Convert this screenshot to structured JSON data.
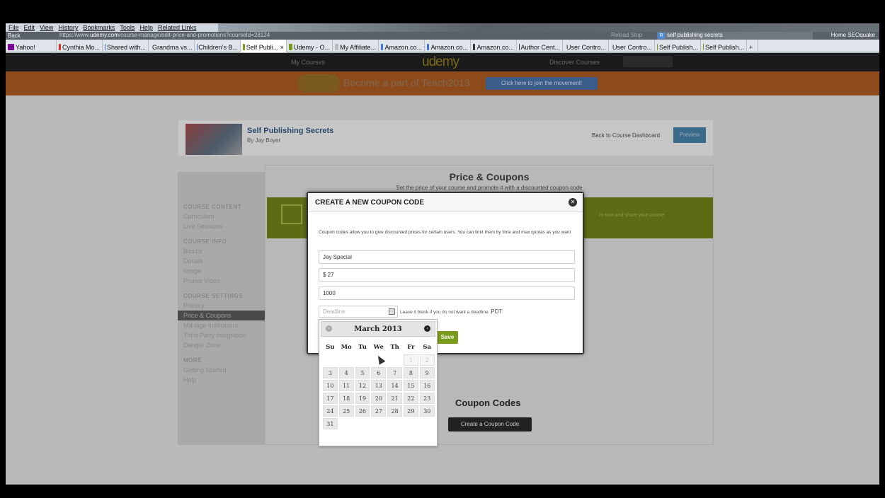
{
  "menubar": [
    "File",
    "Edit",
    "View",
    "History",
    "Bookmarks",
    "Tools",
    "Help",
    "Related Links"
  ],
  "nav": {
    "back": "Back",
    "url_prefix": "https://www.",
    "url_host": "udemy.com",
    "url_path": "/course-manage/edit-price-and-promotions?courseId=28124",
    "reload": "Reload",
    "stop": "Stop",
    "search_value": "self publishing secrets",
    "home": "Home",
    "seoquake": "SEOquake"
  },
  "tabs": [
    {
      "label": "Yahoo!",
      "color": "#7b0099"
    },
    {
      "label": "Cynthia Mo...",
      "color": "#d93025"
    },
    {
      "label": "Shared with...",
      "color": "#3a77d8"
    },
    {
      "label": "Grandma vs...",
      "color": "#3a77d8"
    },
    {
      "label": "Children's B...",
      "color": "#3a77d8"
    },
    {
      "label": "Self Publi... ×",
      "color": "#7a9a1a"
    },
    {
      "label": "Udemy - O...",
      "color": "#7a9a1a"
    },
    {
      "label": "My Affiliate...",
      "color": "#bbbbbb"
    },
    {
      "label": "Amazon.co...",
      "color": "#3a77d8"
    },
    {
      "label": "Amazon.co...",
      "color": "#3a77d8"
    },
    {
      "label": "Amazon.co...",
      "color": "#333333"
    },
    {
      "label": "Author Cent...",
      "color": "#333333"
    },
    {
      "label": "User Contro...",
      "color": "#3a77d8"
    },
    {
      "label": "User Contro...",
      "color": "#3a77d8"
    },
    {
      "label": "Self Publish...",
      "color": "#7a9a1a"
    },
    {
      "label": "Self Publish...",
      "color": "#7a9a1a"
    },
    {
      "label": "+",
      "color": ""
    }
  ],
  "site": {
    "my_courses": "My Courses",
    "logo": "udemy",
    "discover": "Discover Courses",
    "banner_text": "Become a part of Teach2013",
    "banner_button": "Click here to join the movement!"
  },
  "course": {
    "title": "Self Publishing Secrets",
    "by": "By Jay Boyer",
    "back_dashboard": "Back to Course Dashboard",
    "preview": "Preview"
  },
  "sidebar": {
    "sections": [
      {
        "heading": "COURSE CONTENT",
        "items": [
          "Curriculum",
          "Live Sessions"
        ]
      },
      {
        "heading": "COURSE INFO",
        "items": [
          "Basics",
          "Details",
          "Image",
          "Promo Video"
        ]
      },
      {
        "heading": "COURSE SETTINGS",
        "items": [
          "Privacy",
          "Price & Coupons",
          "Manage Instructors",
          "Third Party Integration",
          "Danger Zone"
        ]
      },
      {
        "heading": "MORE",
        "items": [
          "Getting Started",
          "Help"
        ]
      }
    ],
    "selected": "Price & Coupons"
  },
  "main": {
    "heading": "Price & Coupons",
    "subheading": "Set the price of your course and promote it with a discounted coupon code",
    "green_text": "is now and share your course",
    "coupons_heading": "Coupon Codes",
    "create_button": "Create a Coupon Code"
  },
  "modal": {
    "title": "CREATE A NEW COUPON CODE",
    "description": "Coupon codes allow you to give discounted prices for certain users. You can limit them by time and max quotas as you want",
    "code_value": "Jay Special",
    "price_value": "$ 27",
    "quota_value": "1000",
    "deadline_placeholder": "Deadline",
    "deadline_note": "Leave it blank if you do not want a deadline.",
    "timezone": "PDT",
    "save": "Save"
  },
  "datepicker": {
    "month_title": "March 2013",
    "weekdays": [
      "Su",
      "Mo",
      "Tu",
      "We",
      "Th",
      "Fr",
      "Sa"
    ],
    "weeks": [
      [
        null,
        null,
        null,
        null,
        null,
        {
          "d": "1",
          "muted": true
        },
        {
          "d": "2",
          "muted": true
        }
      ],
      [
        "3",
        "4",
        "5",
        "6",
        "7",
        "8",
        "9"
      ],
      [
        "10",
        "11",
        "12",
        "13",
        "14",
        "15",
        "16"
      ],
      [
        "17",
        "18",
        "19",
        "20",
        "21",
        "22",
        "23"
      ],
      [
        "24",
        "25",
        "26",
        "27",
        "28",
        "29",
        "30"
      ],
      [
        "31",
        null,
        null,
        null,
        null,
        null,
        null
      ]
    ]
  }
}
